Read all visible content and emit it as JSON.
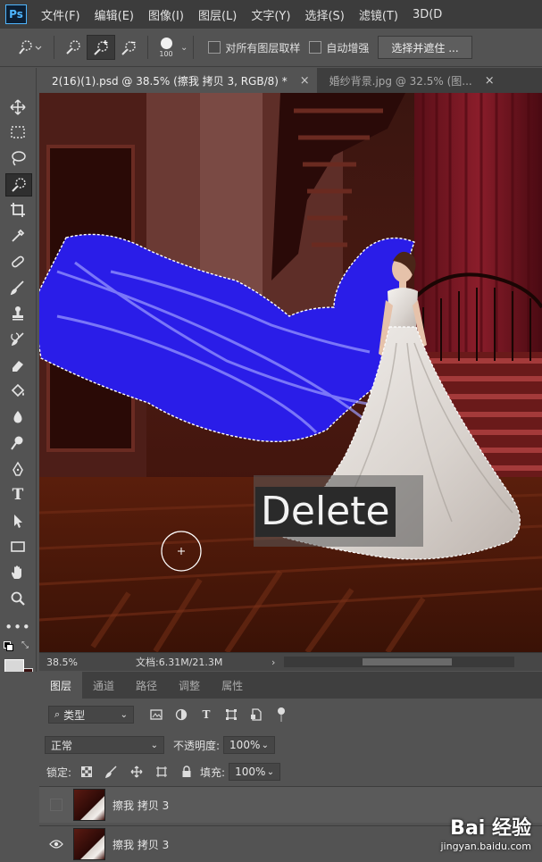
{
  "app": {
    "logo": "Ps"
  },
  "menu": [
    "文件(F)",
    "编辑(E)",
    "图像(I)",
    "图层(L)",
    "文字(Y)",
    "选择(S)",
    "滤镜(T)",
    "3D(D"
  ],
  "options": {
    "brush_size": "100",
    "sample_all_layers": "对所有图层取样",
    "auto_enhance": "自动增强",
    "select_and_mask": "选择并遮住 ..."
  },
  "tabs": [
    {
      "title": "2(16)(1).psd @ 38.5% (擦我 拷贝 3, RGB/8) *",
      "close": "×"
    },
    {
      "title": "婚纱背景.jpg @ 32.5% (图...",
      "close": "×"
    }
  ],
  "canvas": {
    "overlay_text": "Delete"
  },
  "status": {
    "zoom": "38.5%",
    "doc_size": "文档:6.31M/21.3M",
    "arrow": "›"
  },
  "panel_tabs": [
    "图层",
    "通道",
    "路径",
    "调整",
    "属性"
  ],
  "layers_panel": {
    "filter_kind": "类型",
    "blend_mode": "正常",
    "opacity_label": "不透明度:",
    "opacity_value": "100%",
    "lock_label": "锁定:",
    "fill_label": "填充:",
    "fill_value": "100%",
    "layers": [
      {
        "name": "擦我 拷贝 3",
        "visible": false
      },
      {
        "name": "擦我 拷贝 3",
        "visible": true
      }
    ]
  },
  "watermark": {
    "brand": "Bai 经验",
    "url": "jingyan.baidu.com"
  },
  "colors": {
    "accent": "#4fb6ff",
    "selection_overlay": "#2a1de8",
    "panel_bg": "#535353",
    "menubar_bg": "#3c3c3c"
  }
}
